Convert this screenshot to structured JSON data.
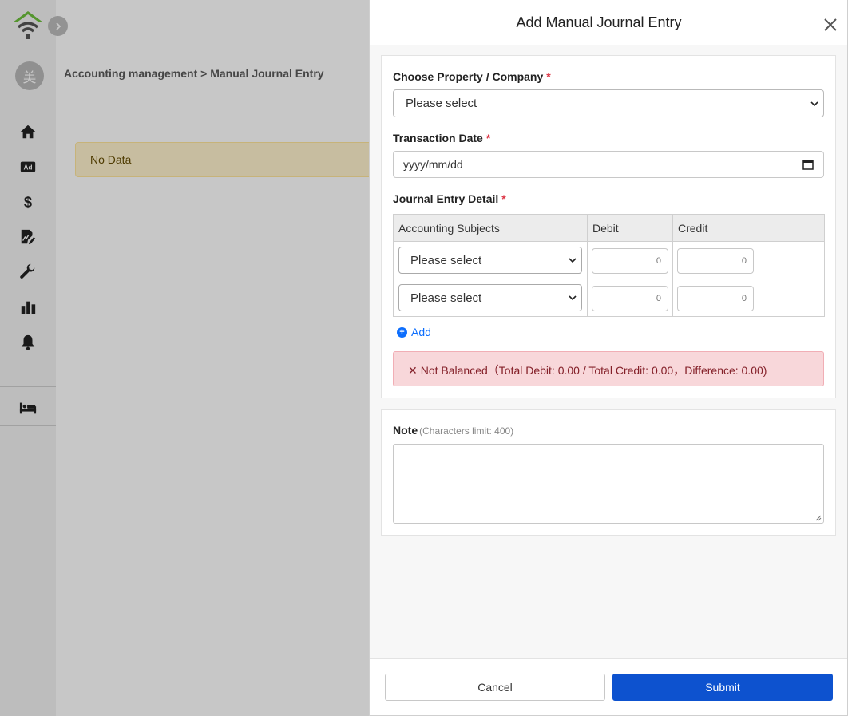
{
  "app": {
    "avatar_char": "美",
    "breadcrumb": "Accounting management > Manual Journal Entry",
    "no_data": "No Data",
    "nav": [
      "home-icon",
      "ad-icon",
      "dollar-icon",
      "report-edit-icon",
      "wrench-icon",
      "bar-chart-icon",
      "bell-icon",
      "bed-icon"
    ]
  },
  "modal": {
    "title": "Add Manual Journal Entry",
    "property_label": "Choose Property / Company",
    "property_value": "Please select",
    "date_label": "Transaction Date",
    "date_placeholder": "yyyy/mm/dd",
    "detail_label": "Journal Entry Detail",
    "required_mark": "*",
    "table": {
      "headers": [
        "Accounting Subjects",
        "Debit",
        "Credit",
        ""
      ],
      "rows": [
        {
          "subject": "Please select",
          "debit": "0",
          "credit": "0"
        },
        {
          "subject": "Please select",
          "debit": "0",
          "credit": "0"
        }
      ]
    },
    "add_label": "Add",
    "balance_alert": "Not Balanced（Total Debit: 0.00 / Total Credit: 0.00，Difference: 0.00)",
    "note_label": "Note",
    "note_hint": "(Characters limit: 400)",
    "note_value": "",
    "cancel_label": "Cancel",
    "submit_label": "Submit"
  },
  "colors": {
    "primary": "#0d52cf",
    "link": "#0d6efd",
    "danger_bg": "#f8d7da",
    "danger_text": "#842029",
    "warning_bg": "#fff3cd",
    "logo_green": "#6cbf3c"
  }
}
